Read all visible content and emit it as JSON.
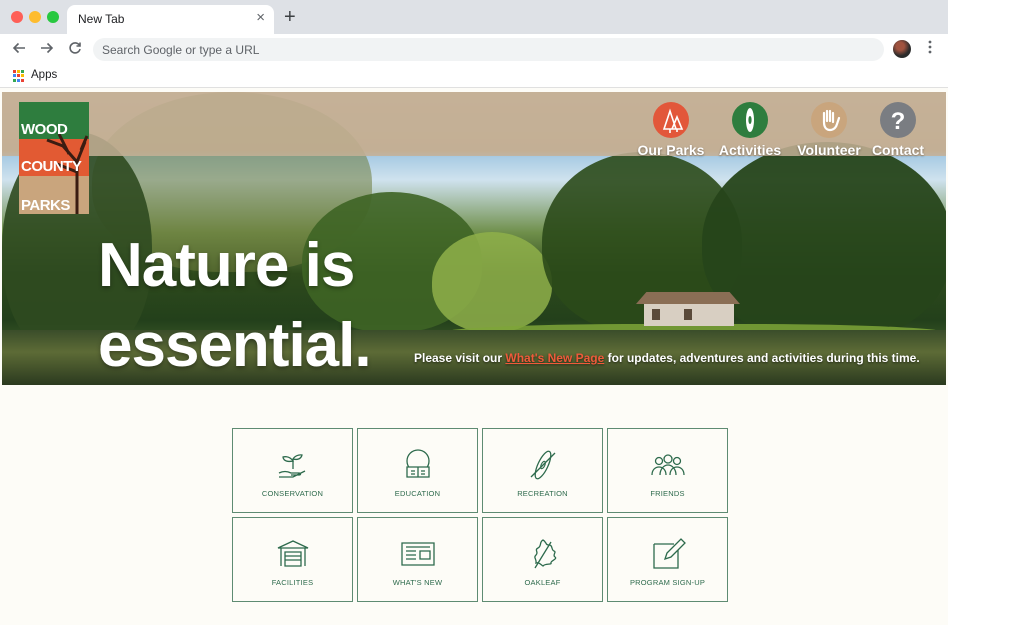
{
  "browser": {
    "tab_title": "New Tab",
    "tab_close": "×",
    "new_tab": "+",
    "omnibox_placeholder": "Search Google or type a URL",
    "apps_label": "Apps",
    "colors": {
      "titlebar": "#dee1e6",
      "omnibox": "#f1f3f4"
    }
  },
  "site": {
    "logo": {
      "lines": [
        "WOOD",
        "COUNTY",
        "PARKS"
      ]
    },
    "nav": [
      {
        "label": "Our Parks",
        "icon": "trees-icon",
        "color": "#e2573a"
      },
      {
        "label": "Activities",
        "icon": "kayak-icon",
        "color": "#2e7d3e"
      },
      {
        "label": "Volunteer",
        "icon": "hand-icon",
        "color": "#c9a57d"
      },
      {
        "label": "Contact",
        "icon": "question-icon",
        "color": "#7a7d82"
      }
    ],
    "headline": [
      "Nature is",
      "essential."
    ],
    "notice": {
      "before": "Please visit our ",
      "link": "What's New Page",
      "after": " for updates, adventures and activities during this time."
    },
    "tiles": [
      {
        "label": "CONSERVATION",
        "icon": "plant-hand-icon"
      },
      {
        "label": "EDUCATION",
        "icon": "book-globe-icon"
      },
      {
        "label": "RECREATION",
        "icon": "kayak-paddle-icon"
      },
      {
        "label": "FRIENDS",
        "icon": "people-group-icon"
      },
      {
        "label": "FACILITIES",
        "icon": "shelter-icon"
      },
      {
        "label": "WHAT'S NEW",
        "icon": "newspaper-icon"
      },
      {
        "label": "OAKLEAF",
        "icon": "oak-leaf-icon"
      },
      {
        "label": "PROGRAM SIGN-UP",
        "icon": "edit-form-icon"
      }
    ],
    "colors": {
      "accent_green": "#2d6a4c",
      "link_orange": "#ef5a3a",
      "page_bg": "#fdfcf7"
    }
  }
}
